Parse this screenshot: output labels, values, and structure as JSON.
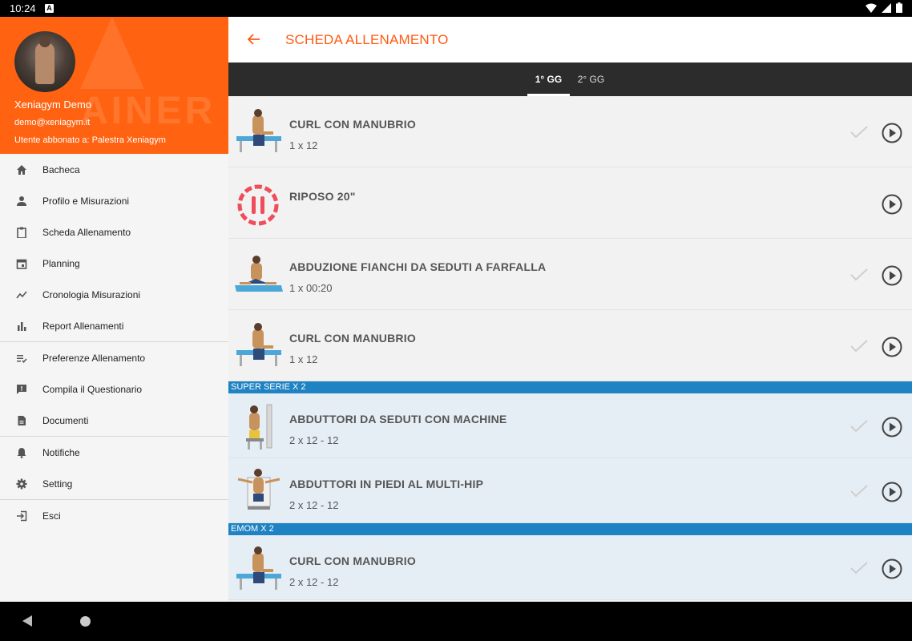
{
  "status": {
    "time": "10:24"
  },
  "drawer": {
    "bg_text": "AINER",
    "user_name": "Xeniagym Demo",
    "email": "demo@xeniagym.it",
    "subscription": "Utente abbonato a: Palestra Xeniagym",
    "items": [
      {
        "label": "Bacheca",
        "icon": "home-icon"
      },
      {
        "label": "Profilo e Misurazioni",
        "icon": "person-icon"
      },
      {
        "label": "Scheda Allenamento",
        "icon": "clipboard-icon"
      },
      {
        "label": "Planning",
        "icon": "calendar-icon"
      },
      {
        "label": "Cronologia Misurazioni",
        "icon": "trend-icon"
      },
      {
        "label": "Report Allenamenti",
        "icon": "bar-chart-icon"
      },
      {
        "label": "Preferenze Allenamento",
        "icon": "list-check-icon"
      },
      {
        "label": "Compila il Questionario",
        "icon": "feedback-icon"
      },
      {
        "label": "Documenti",
        "icon": "document-icon"
      },
      {
        "label": "Notifiche",
        "icon": "bell-icon"
      },
      {
        "label": "Setting",
        "icon": "gear-icon"
      },
      {
        "label": "Esci",
        "icon": "exit-icon"
      }
    ]
  },
  "appbar": {
    "title": "SCHEDA ALLENAMENTO"
  },
  "tabs": [
    {
      "label": "1° GG",
      "active": true
    },
    {
      "label": "2° GG",
      "active": false
    }
  ],
  "rows": [
    {
      "title": "CURL CON MANUBRIO",
      "sub": "1 x 12"
    },
    {
      "title": "RIPOSO 20\"",
      "sub": ""
    },
    {
      "title": "ABDUZIONE FIANCHI DA SEDUTI A FARFALLA",
      "sub": "1 x 00:20"
    },
    {
      "title": "CURL CON MANUBRIO",
      "sub": "1 x 12"
    }
  ],
  "superserie": {
    "label": "SUPER SERIE X 2",
    "rows": [
      {
        "title": "ABDUTTORI DA SEDUTI CON MACHINE",
        "sub": "2 x 12 - 12"
      },
      {
        "title": "ABDUTTORI IN PIEDI AL MULTI-HIP",
        "sub": "2 x 12 - 12"
      }
    ]
  },
  "emom": {
    "label": "EMOM X 2",
    "rows": [
      {
        "title": "CURL CON MANUBRIO",
        "sub": "2 x 12 - 12"
      }
    ]
  },
  "colors": {
    "accent": "#ff6311",
    "section": "#1f82c2",
    "tabs_bg": "#2c2c2c"
  }
}
